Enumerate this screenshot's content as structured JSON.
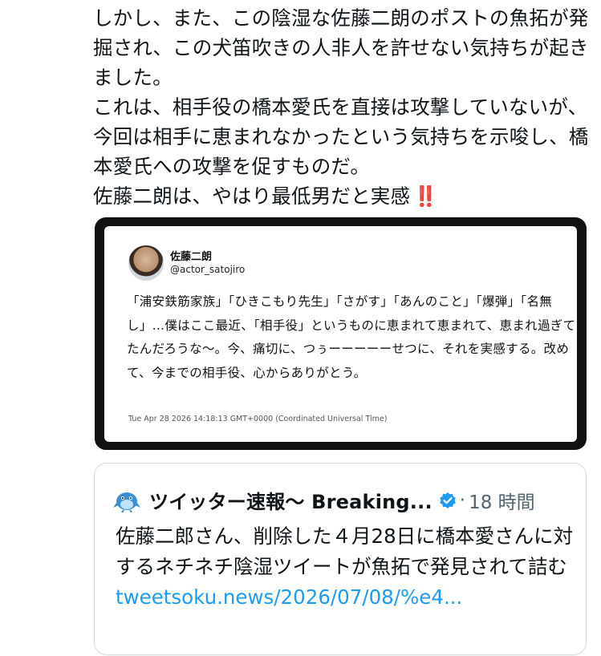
{
  "tweet": {
    "paragraphs": [
      "しかし、また、この陰湿な佐藤二朗のポストの魚拓が発掘され、この犬笛吹きの人非人を許せない気持ちが起きました。",
      "これは、相手役の橋本愛氏を直接は攻撃していないが、今回は相手に恵まれなかったという気持ちを示唆し、橋本愛氏への攻撃を促すものだ。",
      "佐藤二朗は、やはり最低男だと実感"
    ],
    "emphasis_emoji": "‼️"
  },
  "screenshot": {
    "author_name": "佐藤二朗",
    "author_handle": "@actor_satojiro",
    "body": "「浦安鉄筋家族」「ひきこもり先生」「さがす」「あんのこと」「爆弾」「名無し」…僕はここ最近、「相手役」というものに恵まれて恵まれて、恵まれ過ぎてたんだろうな〜。今、痛切に、つぅーーーーーせつに、それを実感する。改めて、今までの相手役、心からありがとう。",
    "timestamp": "Tue Apr 28 2026 14:18:13 GMT+0000 (Coordinated Universal Time)"
  },
  "quoted_card": {
    "account_name": "ツイッター速報〜 Breaking...",
    "separator": "·",
    "time_ago": "18 時間",
    "body": "佐藤二郎さん、削除した４月28日に橋本愛さんに対するネチネチ陰湿ツイートが魚拓で発見されて詰む ",
    "link_text": "tweetsoku.news/2026/07/08/%e4..."
  },
  "colors": {
    "link": "#1d9bf0",
    "verified": "#1d9bf0",
    "muted": "#536471",
    "emoji_red": "#e0245e"
  },
  "icons": {
    "avatar": "avatar-photo",
    "bird": "bird-mascot-icon",
    "verified": "verified-badge-icon"
  }
}
